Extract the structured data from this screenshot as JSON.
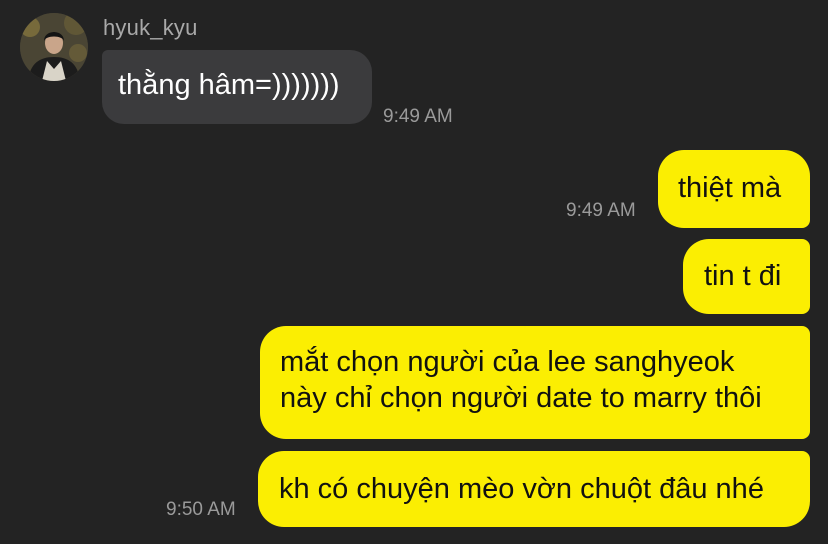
{
  "conversation": {
    "sender_name": "hyuk_kyu",
    "messages": [
      {
        "direction": "incoming",
        "text": "thằng hâm=)))))))",
        "time": "9:49 AM"
      },
      {
        "direction": "outgoing",
        "text": "thiệt mà",
        "time": "9:49 AM"
      },
      {
        "direction": "outgoing",
        "text": "tin t đi",
        "time": ""
      },
      {
        "direction": "outgoing",
        "text": "mắt chọn người của lee sanghyeok\nnày chỉ chọn người date to marry thôi",
        "time": ""
      },
      {
        "direction": "outgoing",
        "text": "kh có chuyện mèo vờn chuột đâu nhé",
        "time": "9:50 AM"
      }
    ]
  },
  "colors": {
    "background": "#232323",
    "incoming_bubble": "#3b3b3d",
    "outgoing_bubble": "#fbee02",
    "timestamp": "#9a9a9a"
  },
  "icons": {
    "avatar": "profile-photo"
  }
}
